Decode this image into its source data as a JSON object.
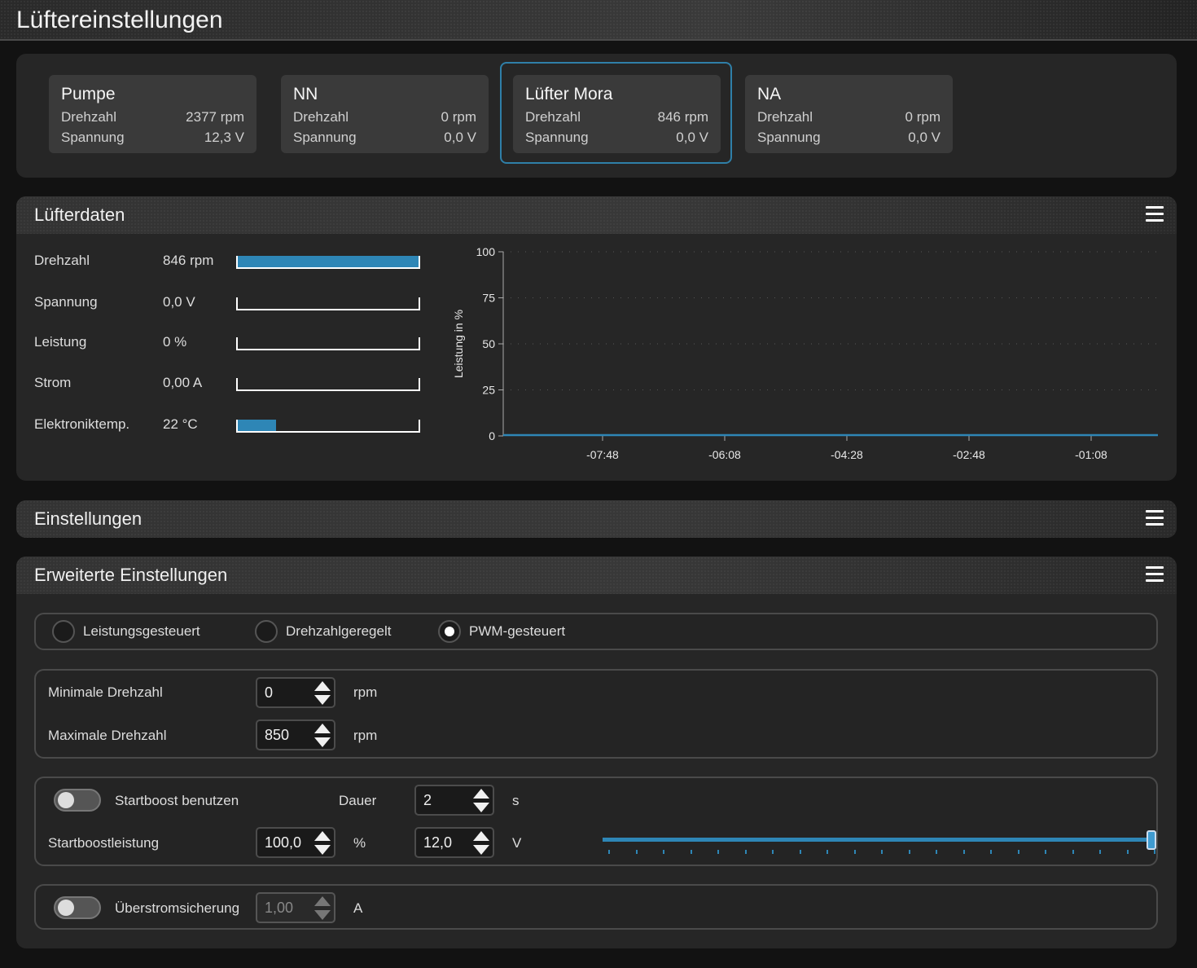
{
  "app": {
    "title": "Lüftereinstellungen"
  },
  "devices": [
    {
      "name": "Pumpe",
      "rpm_label": "Drehzahl",
      "rpm": "2377 rpm",
      "volt_label": "Spannung",
      "volt": "12,3 V"
    },
    {
      "name": "NN",
      "rpm_label": "Drehzahl",
      "rpm": "0 rpm",
      "volt_label": "Spannung",
      "volt": "0,0 V"
    },
    {
      "name": "Lüfter Mora",
      "rpm_label": "Drehzahl",
      "rpm": "846 rpm",
      "volt_label": "Spannung",
      "volt": "0,0 V",
      "selected": true
    },
    {
      "name": "NA",
      "rpm_label": "Drehzahl",
      "rpm": "0 rpm",
      "volt_label": "Spannung",
      "volt": "0,0 V"
    }
  ],
  "fandata": {
    "title": "Lüfterdaten",
    "rows": [
      {
        "label": "Drehzahl",
        "value": "846 rpm",
        "fill": 1.0
      },
      {
        "label": "Spannung",
        "value": "0,0 V",
        "fill": 0.0
      },
      {
        "label": "Leistung",
        "value": "0 %",
        "fill": 0.0
      },
      {
        "label": "Strom",
        "value": "0,00 A",
        "fill": 0.0
      },
      {
        "label": "Elektroniktemp.",
        "value": "22 °C",
        "fill": 0.21
      }
    ]
  },
  "chart_data": {
    "type": "line",
    "ylabel": "Leistung in %",
    "ylim": [
      0,
      100
    ],
    "yticks": [
      "100",
      "75",
      "50",
      "25",
      "0"
    ],
    "xticks": [
      "-07:48",
      "-06:08",
      "-04:28",
      "-02:48",
      "-01:08"
    ],
    "series": [
      {
        "values": [
          0,
          0,
          0,
          0,
          0,
          0
        ]
      }
    ],
    "grid": true,
    "line_color": "#2e86b6"
  },
  "settings": {
    "title": "Einstellungen"
  },
  "advanced": {
    "title": "Erweiterte Einstellungen",
    "modes": [
      {
        "label": "Leistungsgesteuert",
        "selected": false
      },
      {
        "label": "Drehzahlgeregelt",
        "selected": false
      },
      {
        "label": "PWM-gesteuert",
        "selected": true
      }
    ],
    "min_rpm": {
      "label": "Minimale Drehzahl",
      "value": "0",
      "unit": "rpm"
    },
    "max_rpm": {
      "label": "Maximale Drehzahl",
      "value": "850",
      "unit": "rpm"
    },
    "startboost": {
      "toggle_label": "Startboost benutzen",
      "enabled": false,
      "duration_label": "Dauer",
      "duration": "2",
      "duration_unit": "s",
      "power_label": "Startboostleistung",
      "power": "100,0",
      "power_unit": "%",
      "voltage": "12,0",
      "voltage_unit": "V",
      "slider_level": 1.0
    },
    "overcurrent": {
      "toggle_label": "Überstromsicherung",
      "enabled": false,
      "value": "1,00",
      "unit": "A"
    }
  },
  "colors": {
    "accent": "#2e86b6",
    "panel": "#262626",
    "background": "#121212"
  }
}
